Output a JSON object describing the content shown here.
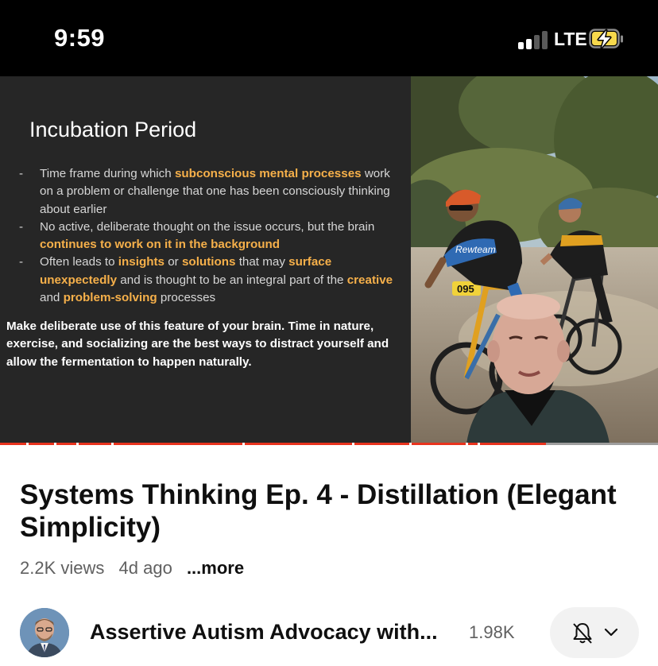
{
  "status_bar": {
    "time": "9:59",
    "network": "LTE",
    "signal_icon": "signal-bars-icon",
    "battery_icon": "battery-charging-icon"
  },
  "player": {
    "slide": {
      "title": "Incubation Period",
      "bullets": [
        [
          {
            "t": "Time frame during which ",
            "h": false
          },
          {
            "t": "subconscious mental processes",
            "h": true
          },
          {
            "t": " work on a problem or challenge that one has been consciously thinking about earlier",
            "h": false
          }
        ],
        [
          {
            "t": "No active, deliberate thought on the issue occurs, but the brain ",
            "h": false
          },
          {
            "t": "continues to work on it in the background",
            "h": true
          }
        ],
        [
          {
            "t": "Often leads to ",
            "h": false
          },
          {
            "t": "insights",
            "h": true
          },
          {
            "t": " or ",
            "h": false
          },
          {
            "t": "solutions",
            "h": true
          },
          {
            "t": " that may ",
            "h": false
          },
          {
            "t": "surface unexpectedly",
            "h": true
          },
          {
            "t": " and is thought to be an integral part of the ",
            "h": false
          },
          {
            "t": "creative",
            "h": true
          },
          {
            "t": " and ",
            "h": false
          },
          {
            "t": "problem-solving",
            "h": true
          },
          {
            "t": " processes",
            "h": false
          }
        ]
      ],
      "takeaway": "Make deliberate use of this feature of your brain. Time in nature, exercise, and socializing are the best ways to distract yourself and allow the fermentation to happen naturally.",
      "bib_number": "095",
      "jersey_text": "Rewteam"
    },
    "progress": 0.83
  },
  "video": {
    "title": "Systems Thinking Ep. 4 - Distillation (Elegant Simplicity)",
    "views": "2.2K views",
    "age": "4d ago",
    "more_label": "...more"
  },
  "channel": {
    "name": "Assertive Autism Advocacy with...",
    "subscribers": "1.98K",
    "bell_icon": "bell-off-icon",
    "dropdown_icon": "chevron-down-icon"
  },
  "colors": {
    "accent_red": "#e8331e",
    "highlight_orange": "#f6b04a",
    "slide_bg": "#262626"
  }
}
